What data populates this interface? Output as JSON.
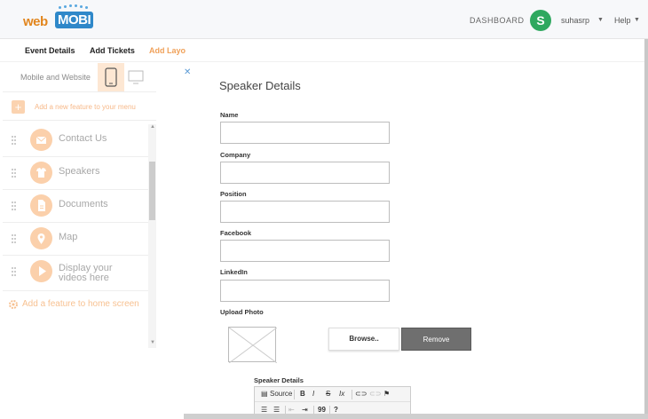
{
  "header": {
    "logo_web": "web",
    "logo_mobi": "MOBI",
    "dashboard": "DASHBOARD",
    "avatar_letter": "S",
    "username": "suhasrp",
    "help": "Help"
  },
  "tabs": [
    {
      "label": "Event Details"
    },
    {
      "label": "Add Tickets"
    },
    {
      "label": "Add Layo"
    }
  ],
  "sidebar": {
    "platform_label": "Mobile and Website",
    "add_feature_menu": "Add a new feature to your menu",
    "features": [
      {
        "label": "Contact Us",
        "icon": "mail-icon"
      },
      {
        "label": "Speakers",
        "icon": "shirt-icon"
      },
      {
        "label": "Documents",
        "icon": "document-icon"
      },
      {
        "label": "Map",
        "icon": "map-pin-icon"
      },
      {
        "label": "Display your videos here",
        "icon": "play-icon"
      }
    ],
    "add_home": "Add a feature to home screen"
  },
  "form": {
    "heading": "Speaker Details",
    "fields": [
      {
        "label": "Name",
        "value": ""
      },
      {
        "label": "Company",
        "value": ""
      },
      {
        "label": "Position",
        "value": ""
      },
      {
        "label": "Facebook",
        "value": ""
      },
      {
        "label": "LinkedIn",
        "value": ""
      }
    ],
    "upload_label": "Upload Photo",
    "browse": "Browse..",
    "remove": "Remove",
    "details_label": "Speaker Details",
    "editor": {
      "source": "Source",
      "bold": "B",
      "italic": "I",
      "strike": "S",
      "clear": "Ix",
      "quote": "99",
      "help": "?"
    }
  },
  "colors": {
    "accent": "#f0a15a",
    "avatar": "#2fa85f",
    "logo_blue": "#2f88c9",
    "logo_orange": "#e2861e"
  }
}
